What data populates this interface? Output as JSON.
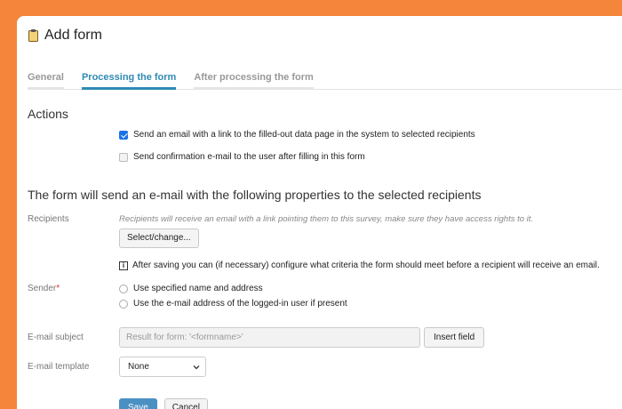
{
  "window": {
    "title": "Add form",
    "title_icon": "clipboard-icon"
  },
  "tabs": [
    {
      "label": "General",
      "active": false
    },
    {
      "label": "Processing the form",
      "active": true
    },
    {
      "label": "After processing the form",
      "active": false
    }
  ],
  "actions": {
    "title": "Actions",
    "option1": {
      "label": "Send an email with a link to the filled-out data page in the system to selected recipients",
      "checked": true
    },
    "option2": {
      "label": "Send confirmation e-mail to the user after filling in this form",
      "checked": false
    }
  },
  "email_section": {
    "title": "The form will send an e-mail with the following properties to the selected recipients"
  },
  "recipients": {
    "label": "Recipients",
    "hint": "Recipients will receive an email with a link pointing them to this survey, make sure they have access rights to it.",
    "button": "Select/change...",
    "info": "After saving you can (if necessary) configure what criteria the form should meet before a recipient will receive an email."
  },
  "sender": {
    "label": "Sender",
    "required_mark": "*",
    "options": [
      "Use specified name and address",
      "Use the e-mail address of the logged-in user if present"
    ]
  },
  "subject": {
    "label": "E-mail subject",
    "value": "Result for form: '<formname>'",
    "button": "Insert field"
  },
  "template": {
    "label": "E-mail template",
    "selected": "None"
  },
  "footer": {
    "save": "Save",
    "cancel": "Cancel"
  },
  "colors": {
    "background": "#f5853a",
    "accent": "#2f8ab3",
    "save_button": "#4a90c2"
  }
}
